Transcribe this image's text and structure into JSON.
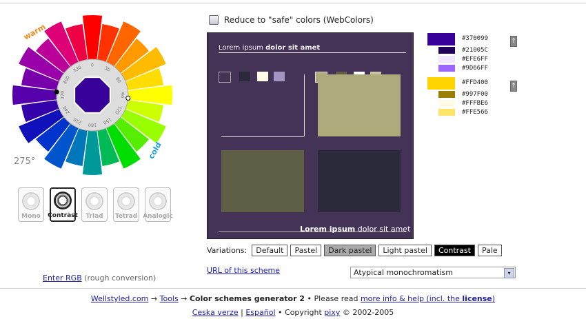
{
  "wheel": {
    "warm_label": "warm",
    "cold_label": "cold",
    "angle_label": "275°",
    "ticks": [
      "0",
      "30",
      "60",
      "90",
      "120",
      "150",
      "180",
      "210",
      "240",
      "270",
      "300",
      "330"
    ],
    "segment_colors": [
      "#ff0000",
      "#ff3300",
      "#ff6600",
      "#ff9900",
      "#ffbb00",
      "#ffdd00",
      "#ffff00",
      "#ccff00",
      "#99ff00",
      "#55ee00",
      "#00dd00",
      "#00bb55",
      "#009999",
      "#0077bb",
      "#0055cc",
      "#0033cc",
      "#1111bb",
      "#3300aa",
      "#5500aa",
      "#7700aa",
      "#9900aa",
      "#bb0099",
      "#dd0077",
      "#ee0044"
    ],
    "center_color": "#370099"
  },
  "modes": [
    {
      "label": "Mono",
      "active": false
    },
    {
      "label": "Contrast",
      "active": true
    },
    {
      "label": "Triad",
      "active": false
    },
    {
      "label": "Tetrad",
      "active": false
    },
    {
      "label": "Analogic",
      "active": false
    }
  ],
  "safe": {
    "label": "Reduce to \"safe\" colors (WebColors)"
  },
  "preview": {
    "title_plain": "Lorem ipsum ",
    "title_bold": "dolor sit amet",
    "footer_bold": "Lorem ipsum",
    "footer_plain": " dolor sit amet",
    "swatches_left": [
      "#443357",
      "#2a2a3a",
      "#fffbe6",
      "#a393c3"
    ],
    "swatches_right": [
      "#aeaa7c",
      "#5f5f45",
      "#ffffff",
      "#c9c6a3"
    ]
  },
  "palette": {
    "group1": [
      {
        "hex": "#370099",
        "color": "#370099"
      },
      {
        "hex": "#21005C",
        "color": "#21005c"
      },
      {
        "hex": "#EFE6FF",
        "color": "#efe6ff"
      },
      {
        "hex": "#9D66FF",
        "color": "#9d66ff"
      }
    ],
    "group2": [
      {
        "hex": "#FFD400",
        "color": "#ffd400"
      },
      {
        "hex": "#997F00",
        "color": "#997f00"
      },
      {
        "hex": "#FFFBE6",
        "color": "#fffbe6"
      },
      {
        "hex": "#FFE566",
        "color": "#ffe566"
      }
    ]
  },
  "variations": {
    "label": "Variations:",
    "items": [
      "Default",
      "Pastel",
      "Dark pastel",
      "Light pastel",
      "Contrast",
      "Pale"
    ]
  },
  "url_label": "URL of this scheme",
  "select_value": "Atypical monochromatism",
  "enter_rgb": "Enter RGB",
  "rough": " (rough conversion)",
  "footer": {
    "site": "Wellstyled.com",
    "arrow": " → ",
    "tools": "Tools",
    "arrow2": " → ",
    "page": "Color schemes generator 2",
    "read": " • Please read ",
    "help": "more info & help (incl. the ",
    "license": "license",
    "close": ")",
    "cz": "Ceska verze",
    "sep": " | ",
    "es": "Español",
    "copy": " • Copyright ",
    "pixy": "pixy",
    "years": " © 2002-2005"
  }
}
